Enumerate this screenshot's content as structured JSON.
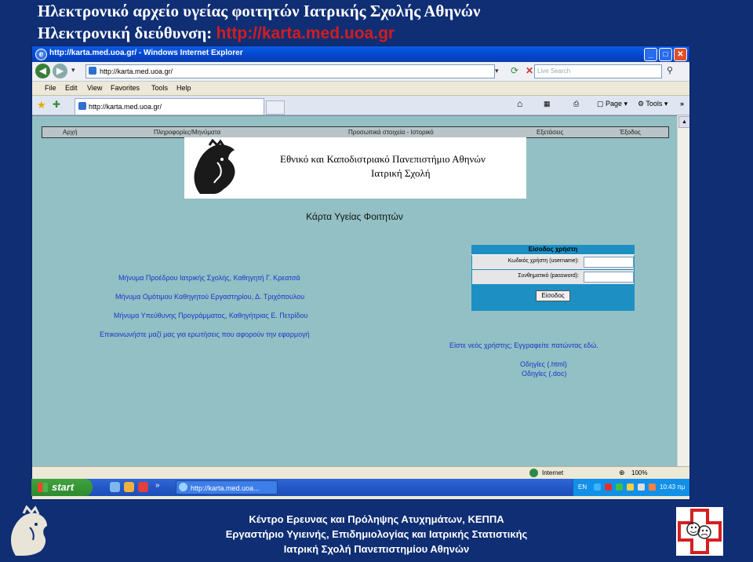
{
  "slide": {
    "title": "Ηλεκτρονικό αρχείο υγείας φοιτητών Ιατρικής Σχολής Αθηνών",
    "subtitle_prefix": "Ηλεκτρονική διεύθυνση: ",
    "subtitle_url": "http://karta.med.uoa.gr"
  },
  "browser": {
    "window_title": "http://karta.med.uoa.gr/ - Windows Internet Explorer",
    "address": "http://karta.med.uoa.gr/",
    "search_placeholder": "Live Search",
    "menu": [
      "File",
      "Edit",
      "View",
      "Favorites",
      "Tools",
      "Help"
    ],
    "tab_label": "http://karta.med.uoa.gr/",
    "command_bar": {
      "page": "Page",
      "tools": "Tools"
    },
    "status": {
      "zone": "Internet",
      "zoom": "100%"
    }
  },
  "site": {
    "nav": [
      "Αρχή",
      "Πληροφορίες/Μηνύματα",
      "Προσωπικά στοιχεία - Ιστορικό",
      "Εξετάσεις",
      "Έξοδος"
    ],
    "banner": {
      "line1": "Εθνικό και Καποδιστριακό Πανεπιστήμιο Αθηνών",
      "line2": "Ιατρική Σχολή"
    },
    "heading": "Κάρτα Υγείας Φοιτητών",
    "messages": [
      "Μήνυμα Προέδρου Ιατρικής Σχολής, Καθηγητή Γ. Κρεατσά",
      "Μήνυμα Ομότιμου Καθηγητού Εργαστηρίου, Δ. Τριχόπουλου",
      "Μήνυμα Υπεύθυνης Προγράμματος, Καθηγήτριας Ε. Πετρίδου",
      "Επικοινωνήστε μαζί μας για ερωτήσεις που αφορούν την εφαρμογή"
    ],
    "login": {
      "title": "Είσοδος χρήστη",
      "username_label": "Κωδικός χρήστη (username):",
      "password_label": "Συνθηματικό (password):",
      "button": "Είσοδος"
    },
    "register_link": "Είστε νεός χρήστης; Εγγραφείτε πατώντας εδώ.",
    "help_html": "Οδηγίες (.html)",
    "help_doc": "Οδηγίες (.doc)"
  },
  "taskbar": {
    "start": "start",
    "task": "http://karta.med.uoa...",
    "lang": "EN",
    "clock": "10:43 πμ"
  },
  "footer": {
    "line1": "Κέντρο Ερευνας και Πρόληψης Ατυχημάτων, ΚΕΠΠΑ",
    "line2": "Εργαστήριο Υγιεινής, Επιδημιολογίας και Ιατρικής Στατιστικής",
    "line3": "Ιατρική Σχολή Πανεπιστημίου Αθηνών"
  }
}
